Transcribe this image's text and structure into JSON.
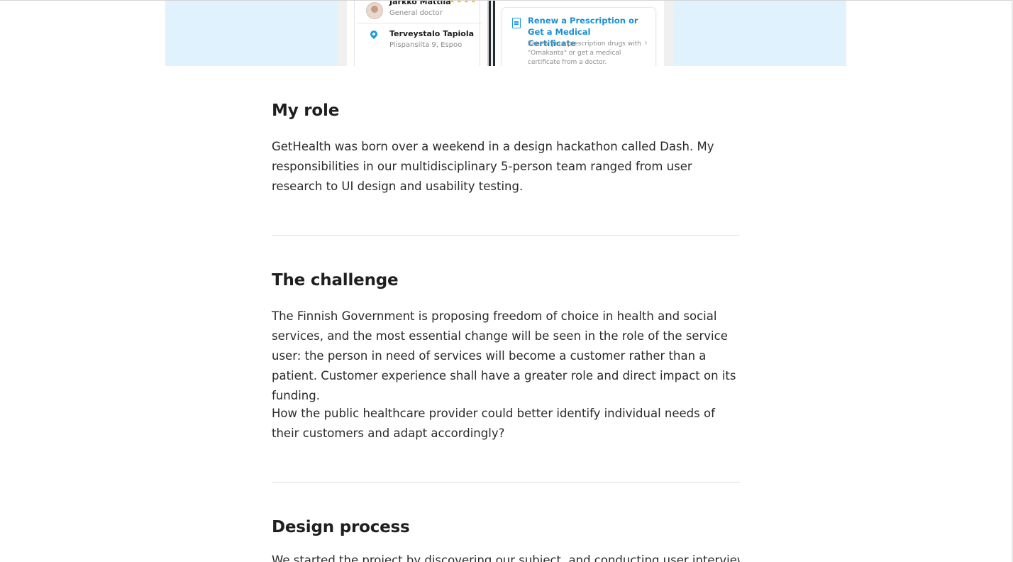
{
  "hero": {
    "doctor_name": "Jarkko Mattila",
    "doctor_rating": "★★★★",
    "doctor_role": "General doctor",
    "location_name": "Terveystalo Tapiola",
    "location_address": "Piispansilta 9, Espoo",
    "card_title": "Renew a Prescription or Get a Medical Certificate",
    "card_description": "Renew your prescription drugs with \"Omakanta\" or get a medical certificate from a doctor.",
    "card_chevron": "›",
    "icons": {
      "avatar": "doctor-avatar",
      "location": "map-pin-icon",
      "document": "document-icon",
      "chevron": "chevron-right-icon"
    }
  },
  "sections": [
    {
      "title": "My role",
      "paragraphs": [
        "GetHealth was born over a weekend in a design hackathon called Dash. My responsibilities in our multidisciplinary 5-person team ranged from user research to UI design and usability testing."
      ]
    },
    {
      "title": "The challenge",
      "paragraphs": [
        "The Finnish Government is proposing freedom of choice in health and social services, and the most essential change will be seen in the role of the service user: the person in need of services will become a customer rather than a patient. Customer experience shall have a greater role and direct impact on its funding.",
        "How the public healthcare provider could better identify individual needs of their customers and adapt accordingly?"
      ]
    },
    {
      "title": "Design process",
      "paragraphs": [
        "We started the project by discovering our subject, and conducting user interviews"
      ]
    }
  ],
  "colors": {
    "hero_background": "#dff2fd",
    "accent_blue": "#1a8fd6",
    "star_yellow": "#f4b400",
    "text": "#1f1f1f",
    "divider": "#dedede"
  }
}
